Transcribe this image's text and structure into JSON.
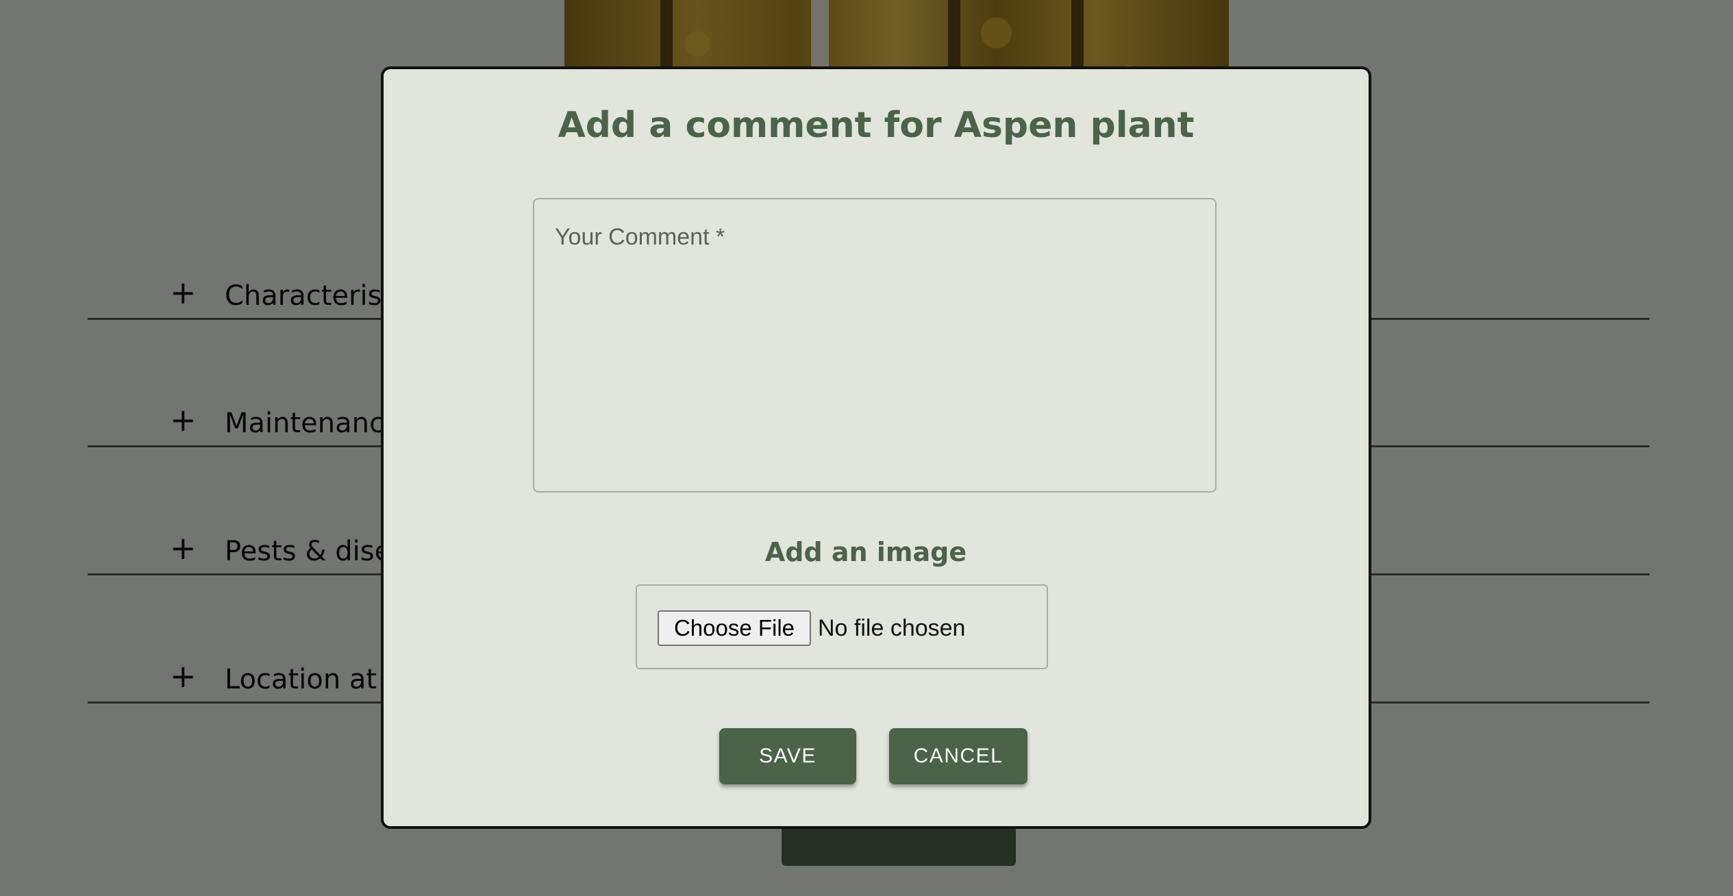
{
  "background": {
    "sections": [
      {
        "label": "Characteristics"
      },
      {
        "label": "Maintenance"
      },
      {
        "label": "Pests & diseases"
      },
      {
        "label": "Location at home"
      }
    ],
    "expand_symbol": "+"
  },
  "dialog": {
    "title": "Add a comment for Aspen plant",
    "comment": {
      "placeholder": "Your Comment *",
      "value": ""
    },
    "image": {
      "heading": "Add an image",
      "choose_file_label": "Choose File",
      "file_status": "No file chosen"
    },
    "actions": {
      "save_label": "SAVE",
      "cancel_label": "CANCEL"
    }
  },
  "colors": {
    "accent": "#4a6349",
    "dialog_bg": "#e1e5dc",
    "backdrop": "rgba(0,0,0,0.5)"
  },
  "icons": {
    "expand": "plus-icon"
  }
}
